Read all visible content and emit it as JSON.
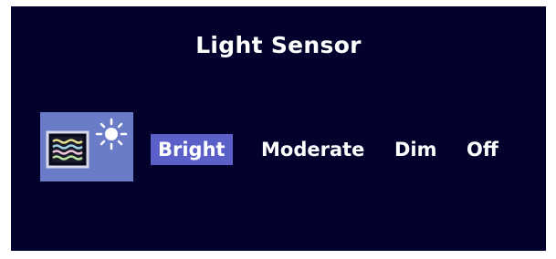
{
  "osd": {
    "title": "Light Sensor",
    "icon": "light-sensor-icon",
    "options": [
      {
        "label": "Bright",
        "selected": true
      },
      {
        "label": "Moderate",
        "selected": false
      },
      {
        "label": "Dim",
        "selected": false
      },
      {
        "label": "Off",
        "selected": false
      }
    ],
    "colors": {
      "background": "#02022c",
      "highlight": "#5a60c8",
      "text": "#ffffff",
      "icon_bg": "#6a7cc8"
    }
  }
}
